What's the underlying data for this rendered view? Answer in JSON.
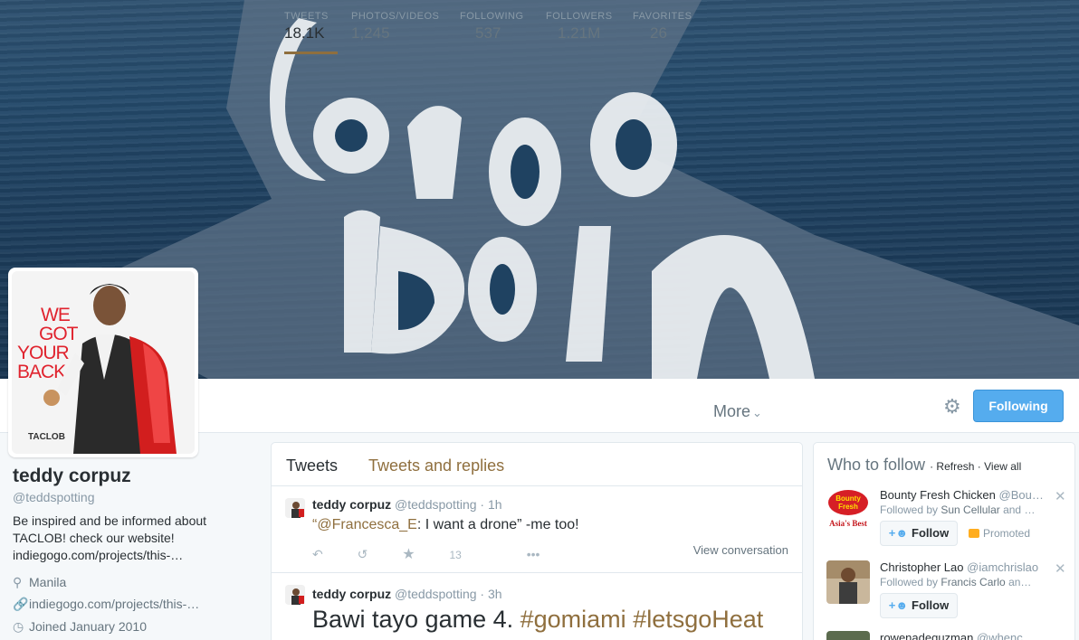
{
  "banner": {
    "art_text": "Carpe Diem"
  },
  "avatar": {
    "slogan_lines": [
      "WE",
      "GOT",
      "YOUR",
      "BACK"
    ],
    "brand": "TACLOB"
  },
  "stats": [
    {
      "label": "TWEETS",
      "value": "18.1K"
    },
    {
      "label": "PHOTOS/VIDEOS",
      "value": "1,245"
    },
    {
      "label": "FOLLOWING",
      "value": "537"
    },
    {
      "label": "FOLLOWERS",
      "value": "1.21M"
    },
    {
      "label": "FAVORITES",
      "value": "26"
    }
  ],
  "nav": {
    "more_label": "More",
    "more_icon": "chevron-down-icon",
    "settings_icon": "gear-icon",
    "following_label": "Following"
  },
  "profile": {
    "name": "teddy corpuz",
    "handle": "@teddspotting",
    "bio_line1": "Be inspired and be informed about",
    "bio_line2": "TACLOB! check our website!",
    "bio_line3": "indiegogo.com/projects/this-…",
    "location": "Manila",
    "website": "indiegogo.com/projects/this-…",
    "joined": "Joined January 2010"
  },
  "timeline": {
    "tabs": [
      "Tweets",
      "Tweets and replies"
    ],
    "tweets": [
      {
        "name": "teddy corpuz",
        "handle": "@teddspotting",
        "time": "· 1h",
        "mention": "“@Francesca_E",
        "text": ": I want a drone” -me too!",
        "favorites": "13",
        "view_conversation": "View conversation"
      },
      {
        "name": "teddy corpuz",
        "handle": "@teddspotting",
        "time": "· 3h",
        "text": "Bawi tayo game 4. ",
        "tag1": "#gomiami",
        "tag2": "#letsgoHeat"
      }
    ]
  },
  "who_to_follow": {
    "title": "Who to follow",
    "refresh": "Refresh",
    "view_all": "View all",
    "suggestions": [
      {
        "name": "Bounty Fresh Chicken",
        "handle": "@Bou…",
        "followed_by_prefix": "Followed by ",
        "followed_by": "Sun Cellular",
        "followed_by_suffix": " and …",
        "follow_label": "Follow",
        "promoted": "Promoted",
        "logo_text": "Bounty Fresh",
        "logo_sub": "Asia's Best"
      },
      {
        "name": "Christopher Lao",
        "handle": "@iamchrislao",
        "followed_by_prefix": "Followed by ",
        "followed_by": "Francis Carlo",
        "followed_by_suffix": " an…",
        "follow_label": "Follow"
      },
      {
        "name": "rowenadeguzman",
        "handle": "@whenc…"
      }
    ]
  },
  "colors": {
    "accent": "#8f6f3e",
    "button_blue": "#55acee"
  }
}
